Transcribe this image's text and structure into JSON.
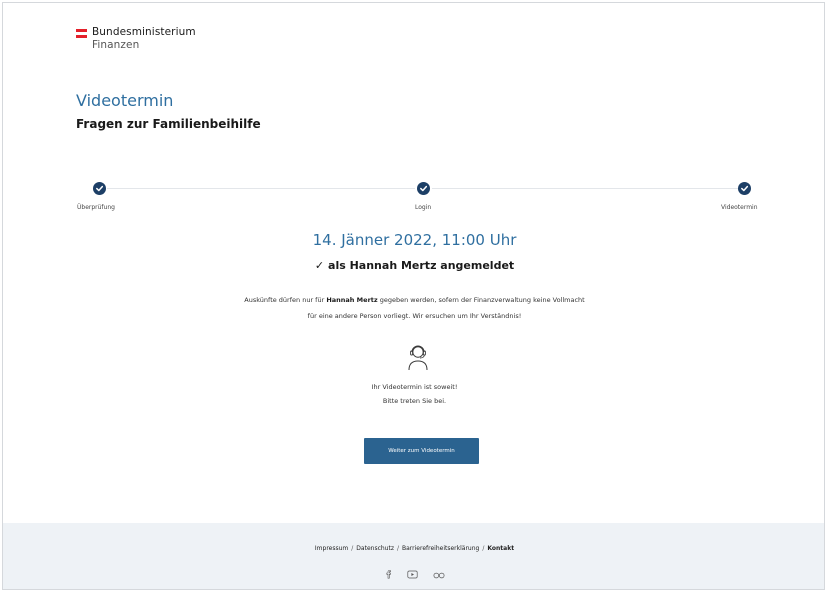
{
  "header": {
    "logo_line1": "Bundesministerium",
    "logo_line2": "Finanzen"
  },
  "page": {
    "title": "Videotermin",
    "subtitle": "Fragen zur Familienbeihilfe"
  },
  "stepper": {
    "steps": [
      {
        "label": "Überprüfung",
        "status": "done"
      },
      {
        "label": "Login",
        "status": "done"
      },
      {
        "label": "Videotermin",
        "status": "done"
      }
    ]
  },
  "content": {
    "date_time": "14. Jänner 2022, 11:00 Uhr",
    "check_symbol": "✓",
    "login_status": "als Hannah Mertz angemeldet",
    "notice_prefix": "Auskünfte dürfen nur für ",
    "notice_name": "Hannah Mertz",
    "notice_suffix": " gegeben werden, sofern der Finanzverwaltung keine Vollmacht",
    "notice_line2": "für eine andere Person vorliegt. Wir ersuchen um Ihr Verständnis!",
    "ready_line1": "Ihr  Videotermin ist soweit!",
    "ready_line2": "Bitte treten Sie bei.",
    "button_label": "Weiter zum Videotermin"
  },
  "footer": {
    "links": [
      "Impressum",
      "Datenschutz",
      "Barrierefreiheitserklärung",
      "Kontakt"
    ],
    "separator": "/",
    "social_icons": [
      "facebook-icon",
      "youtube-icon",
      "flickr-icon"
    ]
  },
  "colors": {
    "accent_blue": "#2f6fa0",
    "step_dot": "#1d3f66",
    "button": "#2b6390",
    "footer_bg": "#eef2f6",
    "flag_red": "#e4202a"
  }
}
